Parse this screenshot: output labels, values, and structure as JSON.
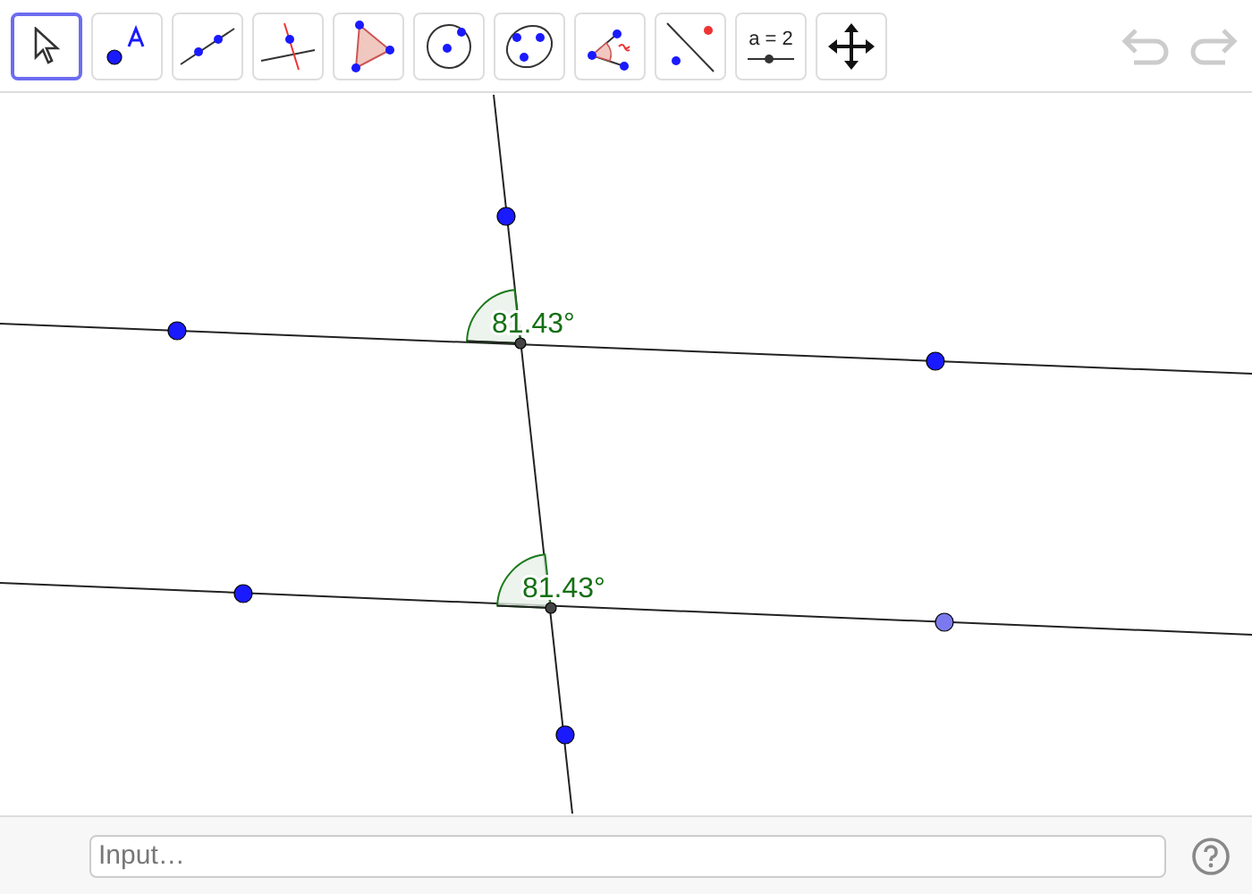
{
  "toolbar": {
    "tools": [
      {
        "kind": "move",
        "selected": true
      },
      {
        "kind": "point",
        "selected": false
      },
      {
        "kind": "line",
        "selected": false
      },
      {
        "kind": "perpendicular",
        "selected": false
      },
      {
        "kind": "polygon",
        "selected": false
      },
      {
        "kind": "circle",
        "selected": false
      },
      {
        "kind": "conic",
        "selected": false
      },
      {
        "kind": "angle",
        "selected": false
      },
      {
        "kind": "reflect",
        "selected": false
      },
      {
        "kind": "slider",
        "selected": false,
        "text": "a = 2"
      },
      {
        "kind": "move-view",
        "selected": false
      }
    ],
    "undo": {
      "disabled": true
    },
    "redo": {
      "disabled": true
    }
  },
  "angles": [
    {
      "label": "81.43°"
    },
    {
      "label": "81.43°"
    }
  ],
  "input_bar": {
    "placeholder": "Input…"
  }
}
